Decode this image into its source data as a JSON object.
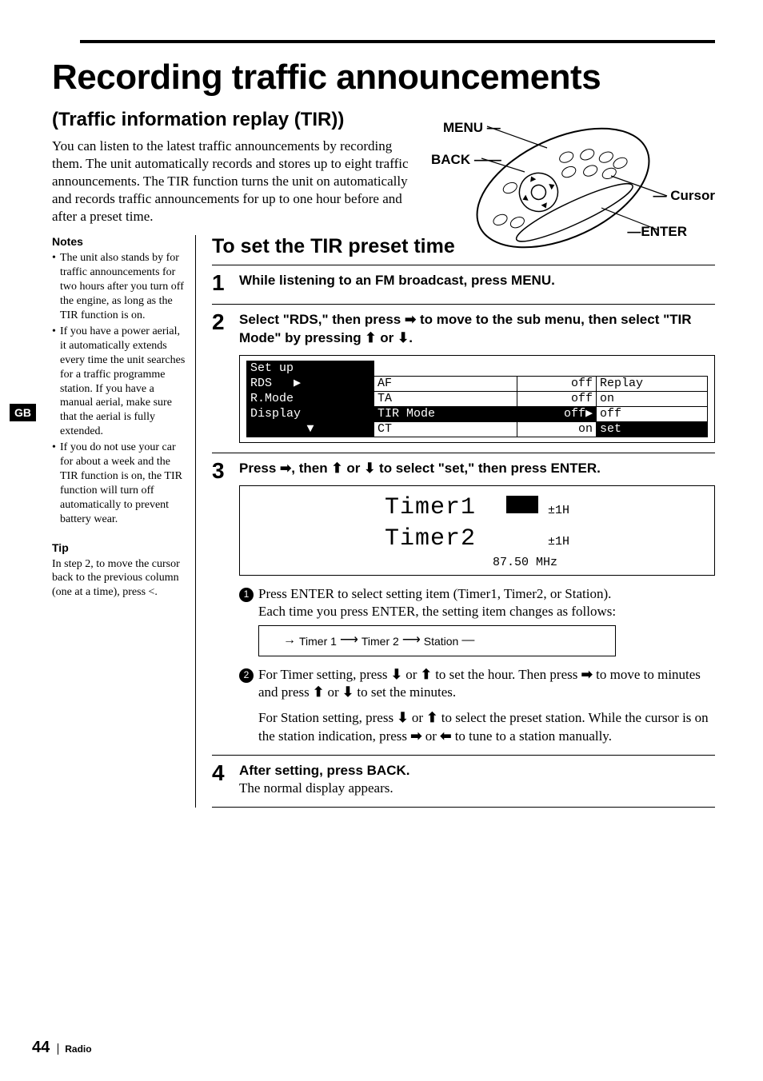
{
  "title": "Recording traffic announcements",
  "subtitle": "(Traffic information replay (TIR))",
  "intro": "You can listen to the latest traffic announcements by recording them. The unit automatically records and stores up to eight traffic announcements. The TIR function turns the unit on automatically and records traffic announcements for up to one hour before and after a preset time.",
  "remote_labels": {
    "menu": "MENU",
    "back": "BACK",
    "cursor": "Cursor",
    "enter": "ENTER"
  },
  "side_tag": "GB",
  "sidebar": {
    "notes_heading": "Notes",
    "notes": [
      "The unit also stands by for traffic announcements for two hours after you turn off the engine, as long as the TIR function is on.",
      "If you have a power aerial, it automatically extends every time the unit searches for a traffic programme station.  If you have a manual aerial, make sure that the aerial is fully extended.",
      "If you do not use your car for about a week and the TIR function is on, the TIR function will turn off automatically to prevent battery wear."
    ],
    "tip_heading": "Tip",
    "tip_text": "In step 2, to move the cursor back to the previous column (one at a time), press <."
  },
  "section_heading": "To set the TIR preset time",
  "steps": {
    "s1": {
      "num": "1",
      "text": "While listening to an FM broadcast, press MENU."
    },
    "s2": {
      "num": "2",
      "text_a": "Select \"RDS,\" then press ",
      "text_b": " to move to the sub menu, then select \"TIR Mode\" by pressing ",
      "text_c": " or ",
      "text_d": ".",
      "menu": {
        "r1c1": "Set up",
        "r1c2": "",
        "r1c3": "",
        "r1c4": "",
        "r2c1": "RDS",
        "r2c2": "AF",
        "r2c3": "off",
        "r2c4": "Replay",
        "r3c1": "R.Mode",
        "r3c2": "TA",
        "r3c3": "off",
        "r3c4": "on",
        "r4c1": "Display",
        "r4c2": "TIR Mode",
        "r4c3": "off",
        "r4c4": "off",
        "r5c1": "▼",
        "r5c2": "CT",
        "r5c3": "on",
        "r5c4": "set",
        "ptr_right": "▶"
      }
    },
    "s3": {
      "num": "3",
      "text_a": "Press ",
      "text_b": ", then ",
      "text_c": " or ",
      "text_d": " to select \"set,\" then press ENTER.",
      "timer": {
        "t1": "Timer1",
        "t1v": "±1H",
        "t2": "Timer2",
        "t2v": "±1H",
        "freq": "87.50 MHz"
      },
      "sub1_a": "Press ENTER to select setting item (Timer1, Timer2, or Station).",
      "sub1_b": "Each time you press ENTER, the setting item changes as follows:",
      "flow": {
        "a": "Timer 1",
        "b": "Timer 2",
        "c": "Station"
      },
      "sub2_a": "For Timer setting, press ",
      "sub2_b": " or ",
      "sub2_c": " to set the hour. Then press ",
      "sub2_d": " to move to minutes and press ",
      "sub2_e": " or ",
      "sub2_f": " to set the minutes.",
      "sub2_g": "For Station setting, press ",
      "sub2_h": " or ",
      "sub2_i": " to select the preset station. While the cursor is on the station indication, press ",
      "sub2_j": " or ",
      "sub2_k": " to tune to a station manually."
    },
    "s4": {
      "num": "4",
      "text_a": "After setting, press BACK.",
      "text_b": "The normal display appears."
    }
  },
  "arrows": {
    "right": "➡",
    "up": "⬆",
    "down": "⬇",
    "left": "⬅"
  },
  "circled": {
    "one": "1",
    "two": "2"
  },
  "footer": {
    "page": "44",
    "section": "Radio"
  }
}
